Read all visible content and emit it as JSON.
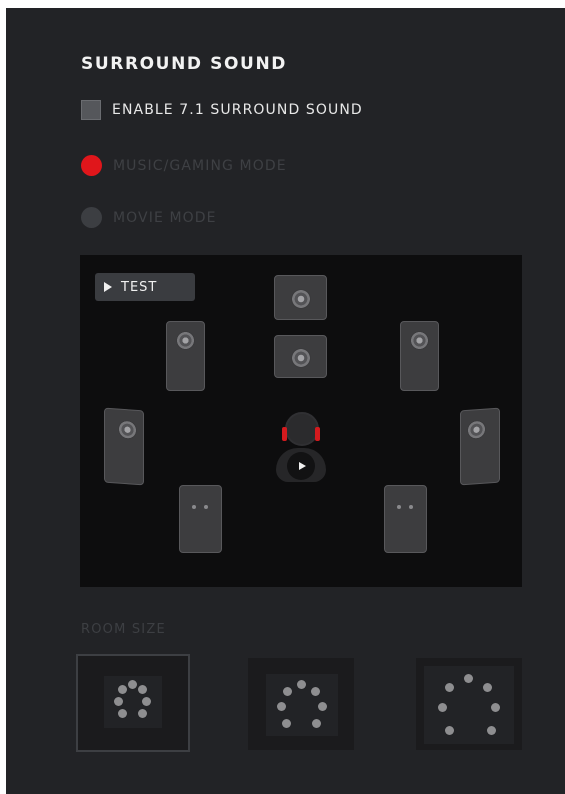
{
  "surround": {
    "title": "SURROUND SOUND",
    "enable_label": "ENABLE 7.1 SURROUND SOUND",
    "enabled": false
  },
  "modes": [
    {
      "label": "MUSIC/GAMING MODE",
      "selected": true
    },
    {
      "label": "MOVIE MODE",
      "selected": false
    }
  ],
  "test_button": {
    "label": "TEST"
  },
  "speakers": [
    "center",
    "front-left",
    "front-right",
    "subwoofer",
    "side-left",
    "side-right",
    "rear-left",
    "rear-right"
  ],
  "room": {
    "label": "ROOM SIZE",
    "options": [
      "small",
      "medium",
      "large"
    ],
    "selected": "small"
  },
  "colors": {
    "background": "#222326",
    "accent": "#e0161b",
    "stage": "#0d0d0e"
  }
}
